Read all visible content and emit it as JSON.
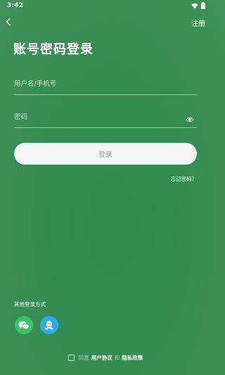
{
  "status_bar": {
    "time": "3:42"
  },
  "header": {
    "back_icon": "chevron-left-icon",
    "register_label": "注册"
  },
  "title": "账号密码登录",
  "form": {
    "username_placeholder": "用户名/手机号",
    "password_placeholder": "密码",
    "password_toggle_icon": "eye-icon",
    "login_label": "登录",
    "forgot_label": "忘记密码？"
  },
  "other_login": {
    "label": "其他登录方式",
    "methods": [
      {
        "icon": "wechat-icon",
        "color": "#38c466"
      },
      {
        "icon": "qq-icon",
        "color": "#2ea8ee"
      }
    ]
  },
  "agreement": {
    "prefix": "同意",
    "user_agreement": "用户协议",
    "conjunction": "和",
    "privacy_policy": "隐私政策"
  },
  "colors": {
    "background": "#338c50",
    "button_bg": "#f2f4f3",
    "button_text": "#9aa19c"
  }
}
